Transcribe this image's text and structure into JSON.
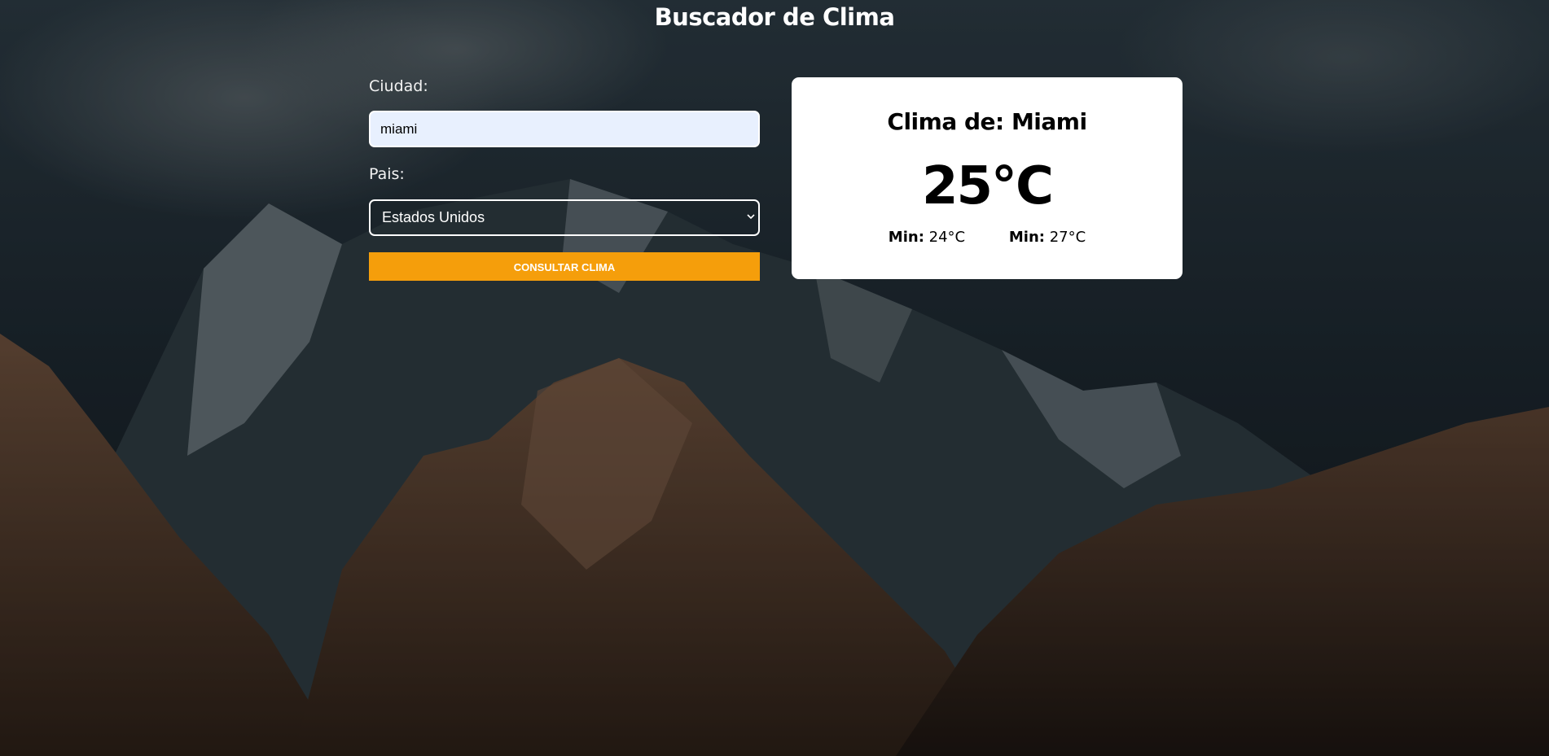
{
  "header": {
    "title": "Buscador de Clima"
  },
  "form": {
    "city_label": "Ciudad:",
    "city_value": "miami",
    "country_label": "Pais:",
    "country_selected": "Estados Unidos",
    "submit_label": "Consultar Clima"
  },
  "weather": {
    "title": "Clima de: Miami",
    "temperature": "25°C",
    "min_label": "Min:",
    "min_value": "24°C",
    "max_label": "Min:",
    "max_value": "27°C"
  },
  "colors": {
    "accent": "#f59e0b",
    "card_bg": "#ffffff",
    "input_bg": "#e8f0fe"
  },
  "icons": {
    "select_chevron": "chevron-down-icon"
  }
}
